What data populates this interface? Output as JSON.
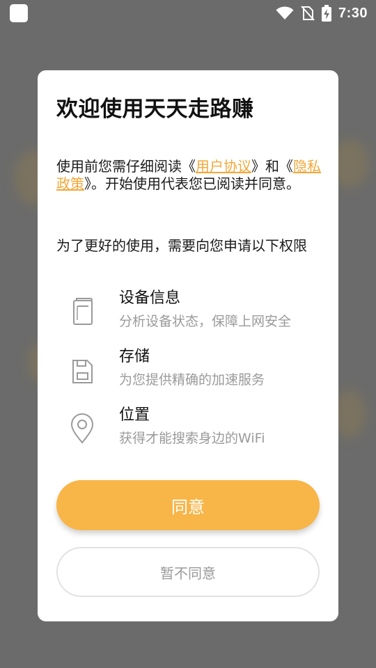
{
  "status_bar": {
    "time": "7:30",
    "icons": [
      "app-icon",
      "wifi-icon",
      "no-sim-icon",
      "battery-charging-icon"
    ]
  },
  "dialog": {
    "title": "欢迎使用天天走路赚",
    "intro": {
      "prefix": "使用前您需仔细阅读《",
      "link_user_agreement": "用户协议",
      "middle": "》和《",
      "link_privacy_policy": "隐私政策",
      "suffix": "》。开始使用代表您已阅读并同意。"
    },
    "permissions_heading": "为了更好的使用，需要向您申请以下权限",
    "permissions": [
      {
        "icon": "device-icon",
        "title": "设备信息",
        "description": "分析设备状态，保障上网安全"
      },
      {
        "icon": "storage-icon",
        "title": "存储",
        "description": "为您提供精确的加速服务"
      },
      {
        "icon": "location-pin-icon",
        "title": "位置",
        "description": "获得才能搜索身边的WiFi"
      }
    ],
    "agree_label": "同意",
    "disagree_label": "暂不同意"
  },
  "colors": {
    "accent": "#f8b548",
    "link": "#f3a83a",
    "overlay": "#6b6b6b",
    "secondary_text": "#9a9a9a"
  }
}
